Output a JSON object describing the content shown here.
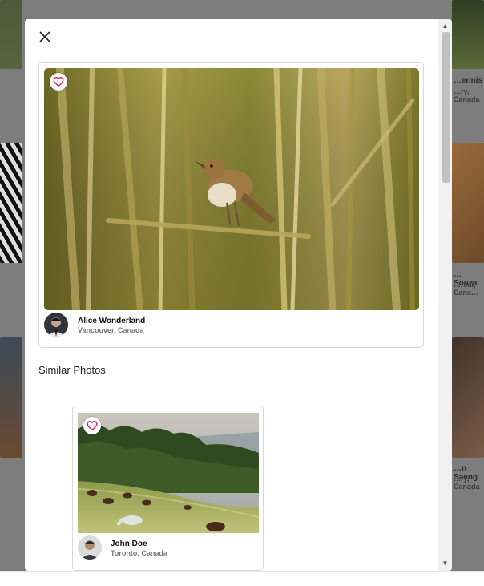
{
  "background_gallery": {
    "items": [
      {
        "name": "…ennis",
        "location": "…ry, Canada"
      },
      {
        "name": "…Souza",
        "location": "…real, Cana…"
      },
      {
        "name": "…n Saeng",
        "location": "…ry, Canada"
      }
    ]
  },
  "modal": {
    "close_icon": "close-icon",
    "main_photo": {
      "alt_subject": "reed warbler bird perched among tall reeds",
      "favorite_icon": "heart-outline-icon",
      "author": {
        "name": "Alice Wonderland",
        "location": "Vancouver, Canada"
      }
    },
    "similar_section": {
      "title": "Similar Photos",
      "items": [
        {
          "alt_subject": "horses grazing on a hillside meadow near forest",
          "favorite_icon": "heart-outline-icon",
          "author": {
            "name": "John Doe",
            "location": "Toronto, Canada"
          }
        }
      ]
    }
  },
  "colors": {
    "heart": "#e0245e",
    "overlay": "#7d7d7d",
    "modal_bg": "#ffffff"
  }
}
